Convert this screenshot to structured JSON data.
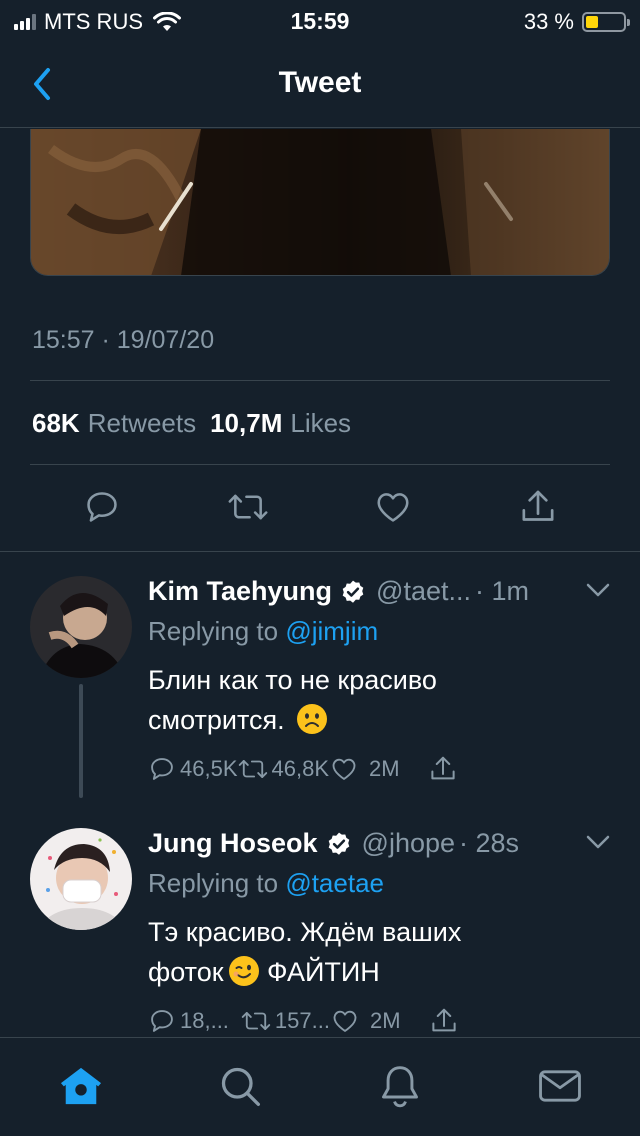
{
  "status_bar": {
    "carrier": "MTS RUS",
    "time": "15:59",
    "battery_percent": "33 %",
    "battery_level": 0.33,
    "icons": [
      "signal-icon",
      "wifi-icon",
      "battery-icon"
    ]
  },
  "header": {
    "title": "Tweet",
    "back_icon": "chevron-left-icon"
  },
  "tweet": {
    "timestamp": "15:57 · 19/07/20",
    "retweets_count": "68K",
    "retweets_label": "Retweets",
    "likes_count": "10,7M",
    "likes_label": "Likes",
    "action_icons": [
      "reply-icon",
      "retweet-icon",
      "like-icon",
      "share-icon"
    ]
  },
  "replies": [
    {
      "name": "Kim Taehyung",
      "handle": "@taet...",
      "time": "· 1m",
      "replying_prefix": "Replying to ",
      "replying_to": "@jimjim",
      "text": "Блин как то не красиво смотрится.",
      "emoji": "frowning-face-emoji",
      "reply_count": "46,5K",
      "retweet_count": "46,8K",
      "like_count": "2M"
    },
    {
      "name": "Jung Hoseok",
      "handle": "@jhope",
      "time": "· 28s",
      "replying_prefix": "Replying to ",
      "replying_to": "@taetae",
      "text_before": "Тэ красиво. Ждём ваших фоток",
      "text_after": " ФАЙТИН",
      "emoji": "winking-face-emoji",
      "reply_count": "18,...",
      "retweet_count": "157...",
      "like_count": "2M"
    }
  ],
  "tabbar": {
    "tabs": [
      "home-icon",
      "search-icon",
      "notifications-icon",
      "messages-icon"
    ],
    "active": "home-icon"
  },
  "colors": {
    "background": "#15202b",
    "divider": "#38444d",
    "secondary_text": "#8899a6",
    "accent": "#1da1f2",
    "battery": "#ffd60a"
  }
}
